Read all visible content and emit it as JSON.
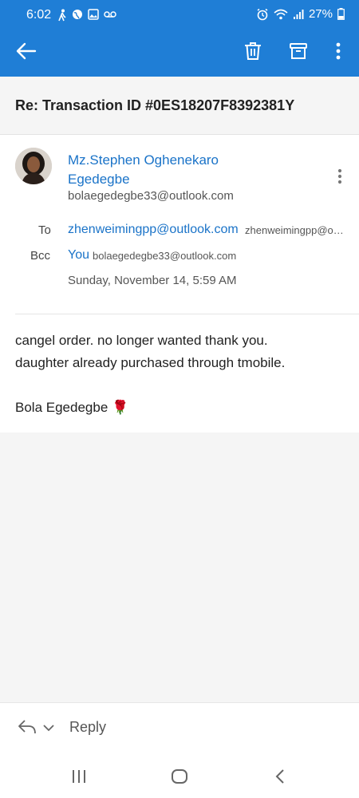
{
  "status_bar": {
    "time": "6:02",
    "battery": "27%",
    "left_icons": [
      "walk-icon",
      "globe-icon",
      "image-icon",
      "voicemail-icon"
    ],
    "right_icons": [
      "alarm-icon",
      "wifi-icon",
      "signal-icon",
      "battery-icon"
    ]
  },
  "toolbar": {
    "back_icon": "arrow-left-icon",
    "delete_icon": "trash-icon",
    "archive_icon": "archive-icon",
    "more_icon": "more-vertical-icon"
  },
  "email": {
    "subject": "Re: Transaction ID #0ES18207F8392381Y",
    "sender_name_line1": "Mz.Stephen Oghenekaro",
    "sender_name_line2": "Egedegbe",
    "sender_email": "bolaegedegbe33@outlook.com",
    "to_label": "To",
    "to_address": "zhenweimingpp@outlook.com",
    "to_address_secondary": "zhenweimingpp@outlook.com",
    "bcc_label": "Bcc",
    "bcc_name": "You",
    "bcc_address": "bolaegedegbe33@outlook.com",
    "date": "Sunday, November 14, 5:59 AM",
    "body_line1": "cangel order. no longer wanted thank you.",
    "body_line2": "daughter already purchased through tmobile.",
    "signature": "Bola Egedegbe 🌹"
  },
  "reply_bar": {
    "reply_label": "Reply"
  },
  "colors": {
    "accent": "#1f7ed6",
    "link": "#1a73c8",
    "background": "#f5f5f5"
  }
}
